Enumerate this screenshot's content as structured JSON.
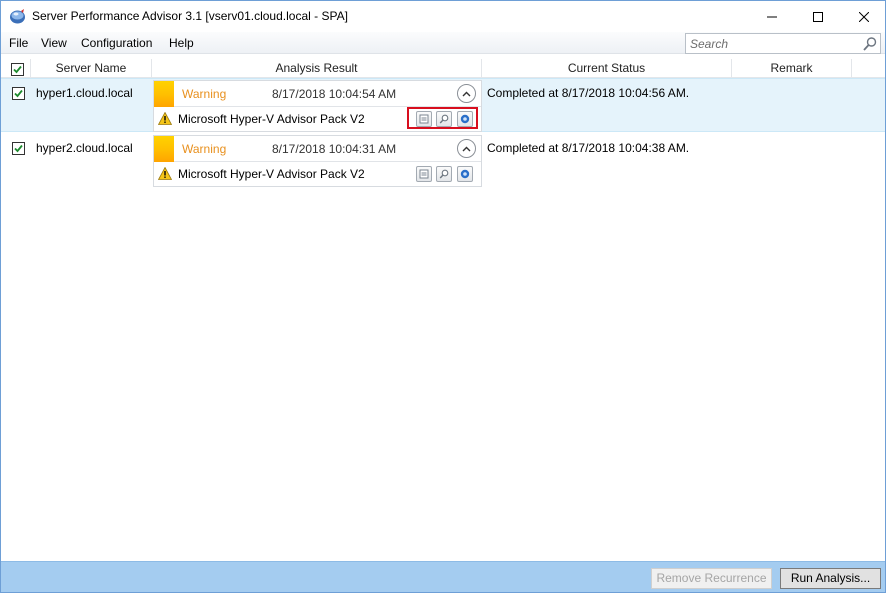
{
  "window": {
    "title": "Server Performance Advisor 3.1 [vserv01.cloud.local - SPA]"
  },
  "menu": {
    "items": [
      "File",
      "View",
      "Configuration",
      "Help"
    ]
  },
  "search": {
    "placeholder": "Search",
    "value": ""
  },
  "columns": {
    "server_name": "Server Name",
    "analysis_result": "Analysis Result",
    "current_status": "Current Status",
    "remark": "Remark"
  },
  "rows": [
    {
      "checked": true,
      "selected": true,
      "server_name": "hyper1.cloud.local",
      "severity": "Warning",
      "result_time": "8/17/2018 10:04:54 AM",
      "pack_name": "Microsoft Hyper-V Advisor Pack V2",
      "status": "Completed at 8/17/2018 10:04:56 AM.",
      "remark": ""
    },
    {
      "checked": true,
      "selected": false,
      "server_name": "hyper2.cloud.local",
      "severity": "Warning",
      "result_time": "8/17/2018 10:04:31 AM",
      "pack_name": "Microsoft Hyper-V Advisor Pack V2",
      "status": "Completed at 8/17/2018 10:04:38 AM.",
      "remark": ""
    }
  ],
  "buttons": {
    "remove_recurrence": "Remove Recurrence",
    "run_analysis": "Run Analysis..."
  },
  "colors": {
    "warning_text": "#e8901e",
    "selected_row": "#e5f3fb",
    "footer": "#a4ccf0",
    "highlight": "#d80e1e"
  }
}
